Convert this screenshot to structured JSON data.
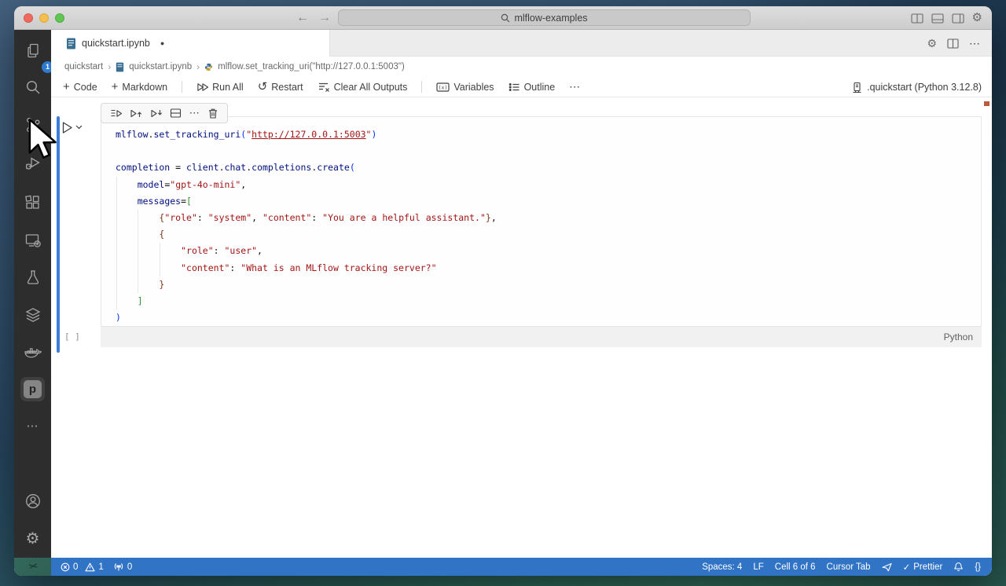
{
  "titlebar": {
    "search_text": "mlflow-examples"
  },
  "tabbar": {
    "active_tab": "quickstart.ipynb"
  },
  "breadcrumb": {
    "items": [
      "quickstart",
      "quickstart.ipynb",
      "mlflow.set_tracking_uri(\"http://127.0.0.1:5003\")"
    ]
  },
  "toolbar": {
    "code": "Code",
    "markdown": "Markdown",
    "run_all": "Run All",
    "restart": "Restart",
    "clear_outputs": "Clear All Outputs",
    "variables": "Variables",
    "outline": "Outline"
  },
  "kernel": {
    "label": ".quickstart (Python 3.12.8)"
  },
  "cell": {
    "exec_count": "[ ]",
    "language": "Python",
    "lines": [
      [
        [
          "id",
          "mlflow"
        ],
        [
          "op",
          "."
        ],
        [
          "id",
          "set_tracking_uri"
        ],
        [
          "p1",
          "("
        ],
        [
          "str",
          "\""
        ],
        [
          "link",
          "http://127.0.0.1:5003"
        ],
        [
          "str",
          "\""
        ],
        [
          "p1",
          ")"
        ]
      ],
      [
        [
          "ws",
          ""
        ]
      ],
      [
        [
          "id",
          "completion"
        ],
        [
          "op",
          " = "
        ],
        [
          "id",
          "client"
        ],
        [
          "op",
          "."
        ],
        [
          "id",
          "chat"
        ],
        [
          "op",
          "."
        ],
        [
          "id",
          "completions"
        ],
        [
          "op",
          "."
        ],
        [
          "id",
          "create"
        ],
        [
          "p1",
          "("
        ]
      ],
      [
        [
          "ws",
          "    "
        ],
        [
          "id",
          "model"
        ],
        [
          "op",
          "="
        ],
        [
          "str",
          "\"gpt-4o-mini\""
        ],
        [
          "op",
          ","
        ]
      ],
      [
        [
          "ws",
          "    "
        ],
        [
          "id",
          "messages"
        ],
        [
          "op",
          "="
        ],
        [
          "p2",
          "["
        ]
      ],
      [
        [
          "ws",
          "        "
        ],
        [
          "p3",
          "{"
        ],
        [
          "str",
          "\"role\""
        ],
        [
          "op",
          ": "
        ],
        [
          "str",
          "\"system\""
        ],
        [
          "op",
          ", "
        ],
        [
          "str",
          "\"content\""
        ],
        [
          "op",
          ": "
        ],
        [
          "str",
          "\"You are a helpful assistant.\""
        ],
        [
          "p3",
          "}"
        ],
        [
          "op",
          ","
        ]
      ],
      [
        [
          "ws",
          "        "
        ],
        [
          "p3",
          "{"
        ]
      ],
      [
        [
          "ws",
          "            "
        ],
        [
          "str",
          "\"role\""
        ],
        [
          "op",
          ": "
        ],
        [
          "str",
          "\"user\""
        ],
        [
          "op",
          ","
        ]
      ],
      [
        [
          "ws",
          "            "
        ],
        [
          "str",
          "\"content\""
        ],
        [
          "op",
          ": "
        ],
        [
          "str",
          "\"What is an MLflow tracking server?\""
        ]
      ],
      [
        [
          "ws",
          "        "
        ],
        [
          "p3",
          "}"
        ]
      ],
      [
        [
          "ws",
          "    "
        ],
        [
          "p2",
          "]"
        ]
      ],
      [
        [
          "p1",
          ")"
        ]
      ]
    ]
  },
  "status_bar": {
    "errors": "0",
    "warnings": "1",
    "ports": "0",
    "spaces": "Spaces: 4",
    "eol": "LF",
    "cell_position": "Cell 6 of 6",
    "cursor_tab": "Cursor Tab",
    "formatter": "Prettier",
    "brackets": "{}"
  },
  "activity_bar": {
    "explorer_badge": "1",
    "p_extension": "p"
  },
  "icons": {
    "back": "←",
    "forward": "→",
    "plus": "+",
    "restart": "↺",
    "more": "⋯",
    "separator": "›",
    "modified_dot": "●",
    "gear": "⚙",
    "check": "✓",
    "remote": "><"
  },
  "colors": {
    "accent_blue": "#3b7dd8",
    "status_bar_blue": "#3173c5",
    "string_red": "#a31515",
    "identifier_blue": "#001080",
    "badge_blue": "#2f7ad1",
    "marker_orange": "#bb5a3c"
  }
}
